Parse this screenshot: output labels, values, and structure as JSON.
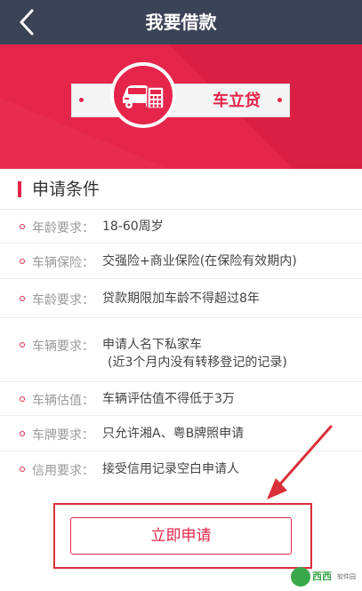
{
  "header": {
    "title": "我要借款",
    "back_icon": "chevron-left-icon"
  },
  "hero": {
    "product_label": "车立贷",
    "emblem_icon": "car-calculator-icon",
    "colors": {
      "brand_red": "#e6254a",
      "top_bar": "#3b4356"
    }
  },
  "conditions": {
    "title": "申请条件",
    "items": [
      {
        "label": "年龄要求：",
        "value": "18-60周岁"
      },
      {
        "label": "车辆保险：",
        "value": "交强险+商业保险(在保险有效期内)"
      },
      {
        "label": "车龄要求：",
        "value": "贷款期限加车龄不得超过8年"
      },
      {
        "label": "车辆要求：",
        "value": "申请人名下私家车",
        "value2": "(近3个月内没有转移登记的记录)"
      },
      {
        "label": "车辆估值：",
        "value": "车辆评估值不得低于3万"
      },
      {
        "label": "车牌要求：",
        "value": "只允许湘A、粤B牌照申请"
      },
      {
        "label": "信用要求：",
        "value": "接受信用记录空白申请人"
      }
    ]
  },
  "actions": {
    "apply_label": "立即申请"
  },
  "watermark": {
    "brand": "西西",
    "sub": "软件园"
  }
}
